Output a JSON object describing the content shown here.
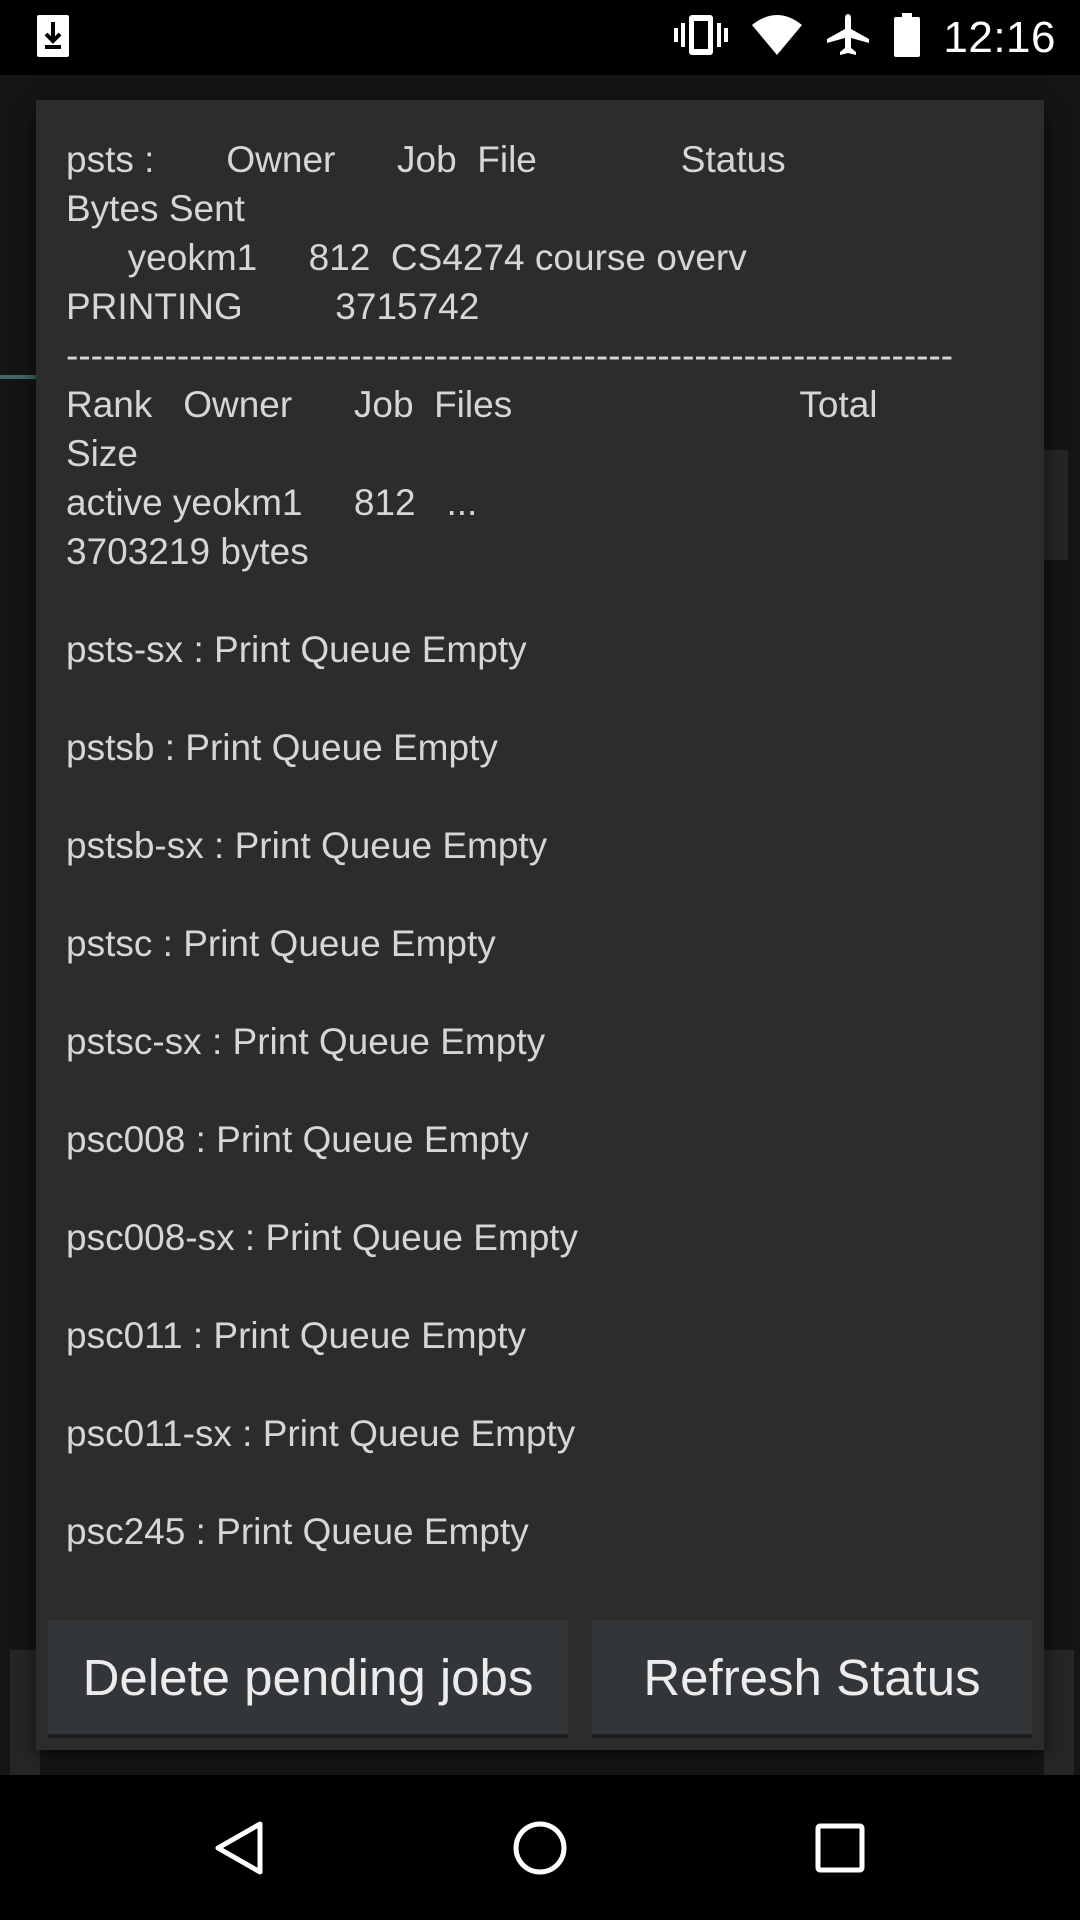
{
  "status_bar": {
    "time": "12:16",
    "icons": [
      "download-icon",
      "vibrate-icon",
      "wifi-icon",
      "airplane-icon",
      "battery-icon"
    ]
  },
  "dialog": {
    "lines": [
      "psts :       Owner      Job  File              Status",
      "Bytes Sent",
      "      yeokm1     812  CS4274 course overv",
      "PRINTING         3715742",
      "------------------------------------------------------------------------",
      "Rank   Owner      Job  Files                            Total",
      "Size",
      "active yeokm1     812   ...",
      "3703219 bytes",
      "",
      "psts-sx : Print Queue Empty",
      "",
      "pstsb : Print Queue Empty",
      "",
      "pstsb-sx : Print Queue Empty",
      "",
      "pstsc : Print Queue Empty",
      "",
      "pstsc-sx : Print Queue Empty",
      "",
      "psc008 : Print Queue Empty",
      "",
      "psc008-sx : Print Queue Empty",
      "",
      "psc011 : Print Queue Empty",
      "",
      "psc011-sx : Print Queue Empty",
      "",
      "psc245 : Print Queue Empty"
    ],
    "buttons": {
      "delete_label": "Delete pending jobs",
      "refresh_label": "Refresh Status"
    }
  },
  "nav_bar": {
    "icons": [
      "back-icon",
      "home-icon",
      "recents-icon"
    ]
  },
  "colors": {
    "status_bar": "#000000",
    "dialog_bg": "#2c2c2c",
    "button_bg": "#333638",
    "text": "#d6d6d6"
  }
}
